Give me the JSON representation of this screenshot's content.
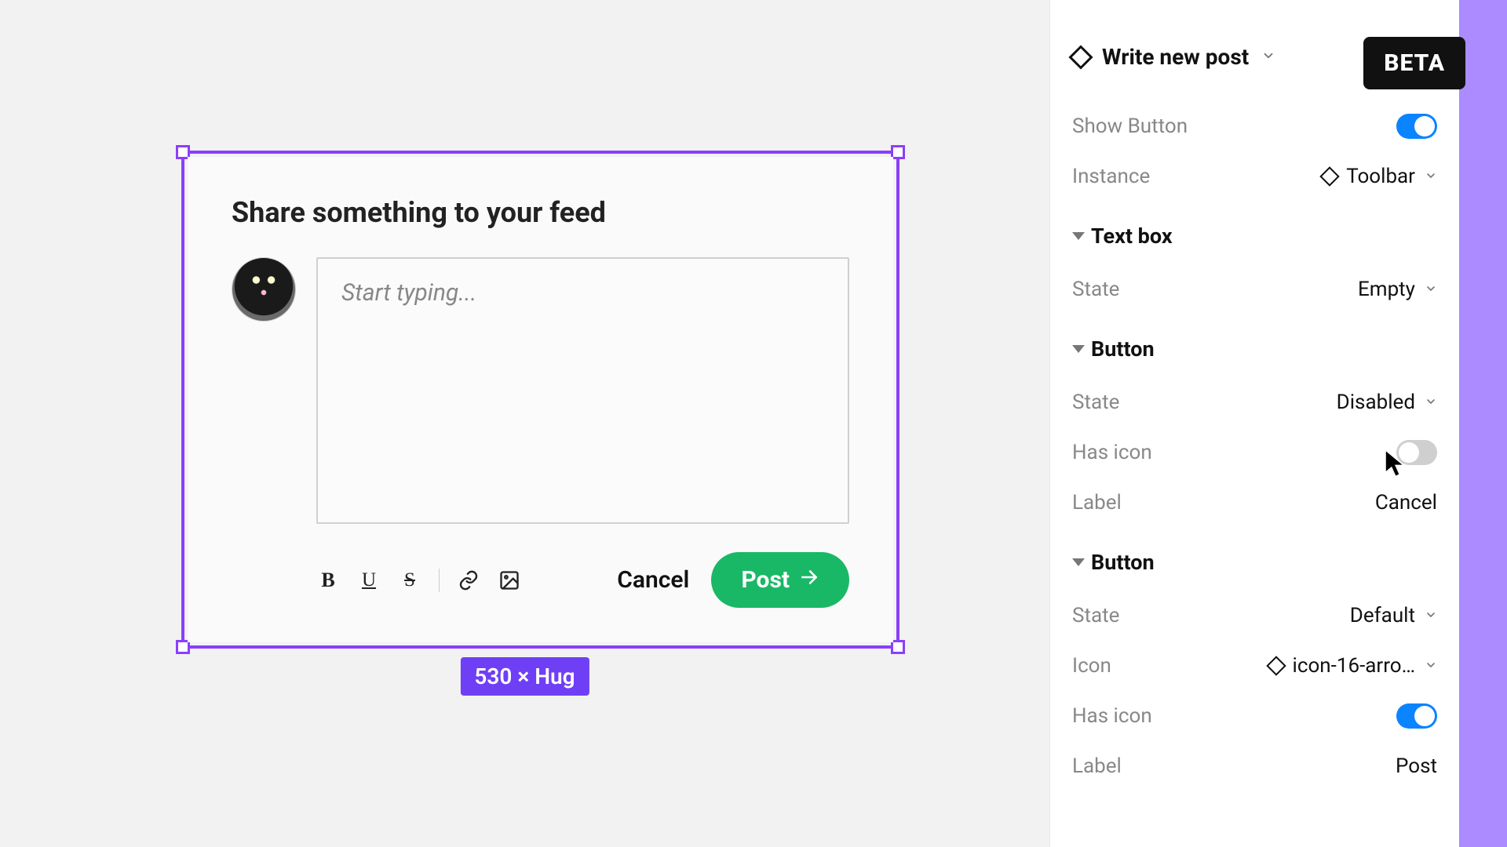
{
  "canvas": {
    "card_title": "Share something to your feed",
    "textarea_placeholder": "Start typing...",
    "toolbar": {
      "bold": "B",
      "underline": "U",
      "strike": "S"
    },
    "cancel_label": "Cancel",
    "post_label": "Post",
    "dimensions_badge": "530 × Hug"
  },
  "panel": {
    "component_name": "Write new post",
    "beta_label": "BETA",
    "show_button": {
      "label": "Show Button",
      "value": true
    },
    "instance": {
      "label": "Instance",
      "value": "Toolbar"
    },
    "sections": [
      {
        "title": "Text box",
        "rows": [
          {
            "label": "State",
            "type": "select",
            "value": "Empty"
          }
        ]
      },
      {
        "title": "Button",
        "rows": [
          {
            "label": "State",
            "type": "select",
            "value": "Disabled"
          },
          {
            "label": "Has icon",
            "type": "toggle",
            "value": false
          },
          {
            "label": "Label",
            "type": "text",
            "value": "Cancel"
          }
        ]
      },
      {
        "title": "Button",
        "rows": [
          {
            "label": "State",
            "type": "select",
            "value": "Default"
          },
          {
            "label": "Icon",
            "type": "instance",
            "value": "icon-16-arro…"
          },
          {
            "label": "Has icon",
            "type": "toggle",
            "value": true
          },
          {
            "label": "Label",
            "type": "text",
            "value": "Post"
          }
        ]
      }
    ]
  }
}
